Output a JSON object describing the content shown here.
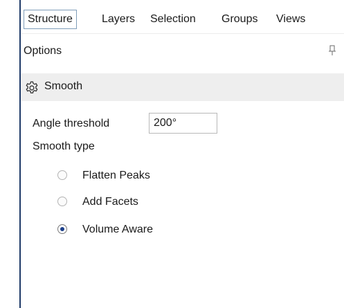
{
  "tabs": {
    "structure": "Structure",
    "layers": "Layers",
    "selection": "Selection",
    "groups": "Groups",
    "views": "Views",
    "active": "Structure"
  },
  "options_panel": {
    "title": "Options",
    "pin_icon": "pin-icon",
    "tool": {
      "icon": "gear-icon",
      "label": "Smooth"
    },
    "angle_threshold": {
      "label": "Angle threshold",
      "value": "200°"
    },
    "smooth_type": {
      "label": "Smooth type",
      "options": [
        {
          "label": "Flatten Peaks",
          "checked": false
        },
        {
          "label": "Add Facets",
          "checked": false
        },
        {
          "label": "Volume Aware",
          "checked": true
        }
      ]
    }
  },
  "colors": {
    "accent": "#1b3f8a",
    "tool_row_bg": "#eeeeee",
    "left_rule": "#1f3a68"
  }
}
